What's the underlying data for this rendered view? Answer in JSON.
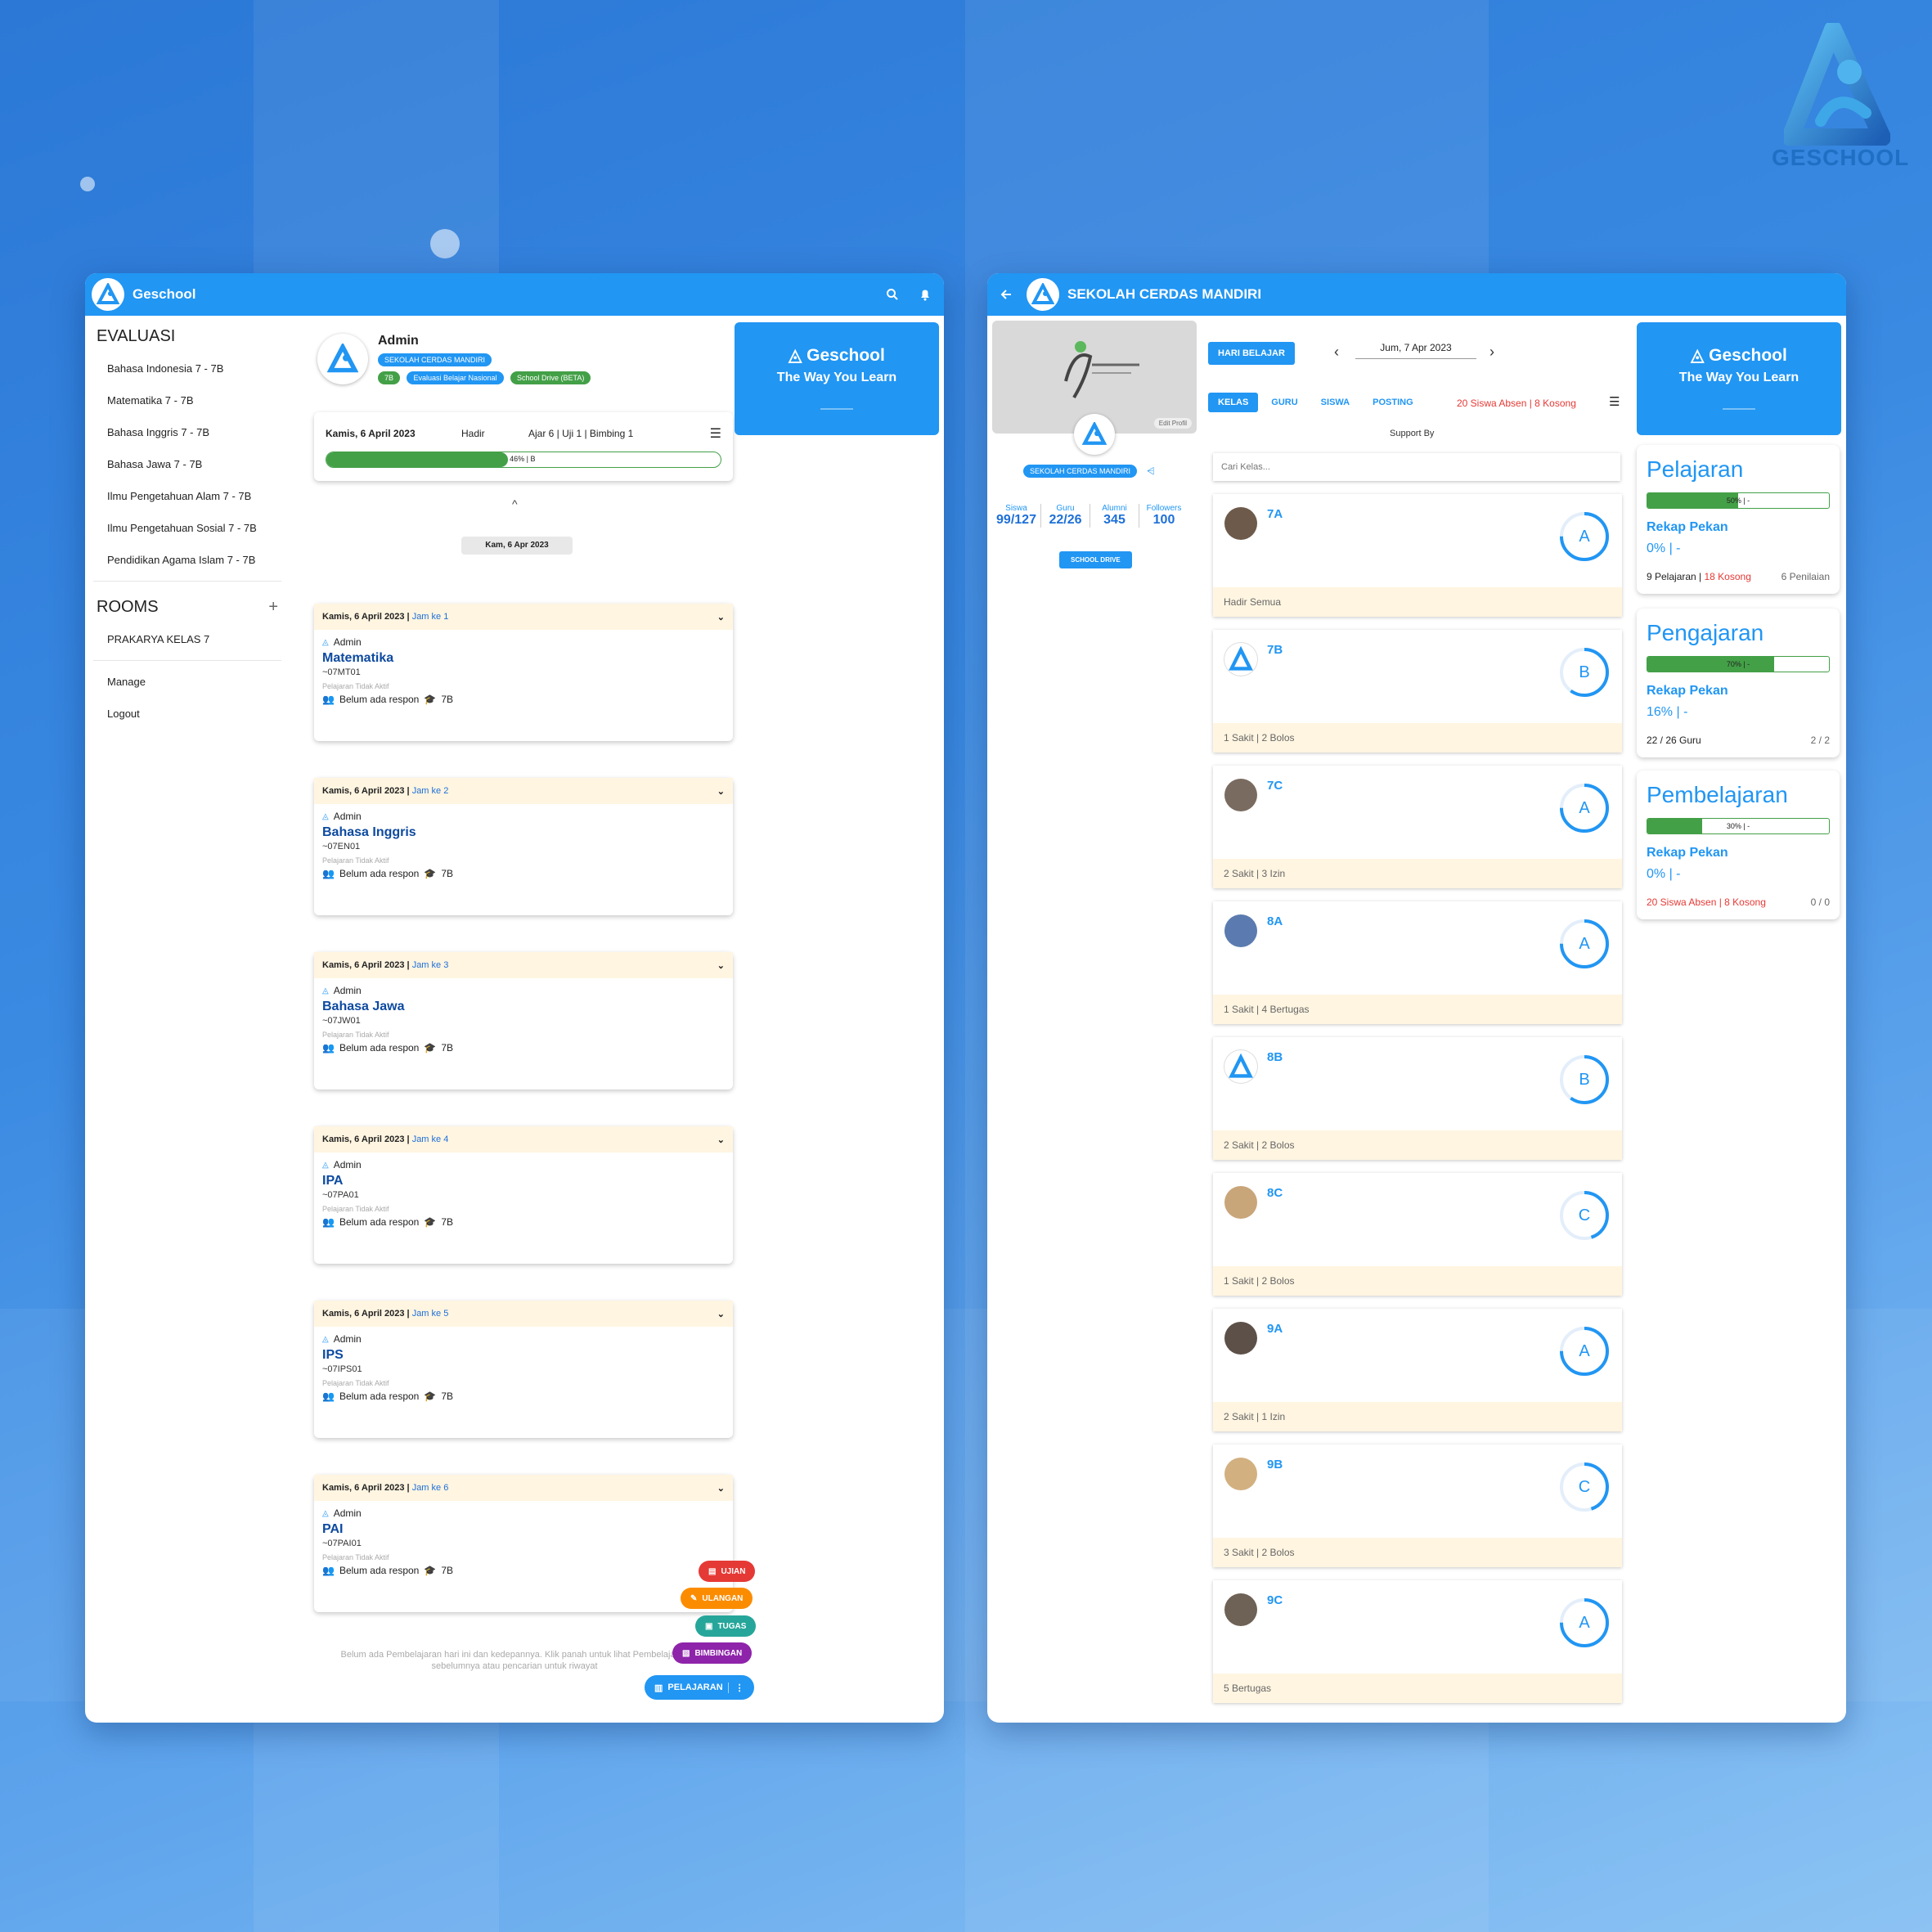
{
  "brand": {
    "name": "GESCHOOL"
  },
  "left": {
    "app_title": "Geschool",
    "evaluasi": {
      "title": "EVALUASI",
      "items": [
        "Bahasa Indonesia 7 - 7B",
        "Matematika 7 - 7B",
        "Bahasa Inggris 7 - 7B",
        "Bahasa Jawa 7 - 7B",
        "Ilmu Pengetahuan Alam 7 - 7B",
        "Ilmu Pengetahuan Sosial 7 - 7B",
        "Pendidikan Agama Islam 7 - 7B"
      ]
    },
    "rooms": {
      "title": "ROOMS",
      "items": [
        "PRAKARYA KELAS 7"
      ]
    },
    "manage": "Manage",
    "logout": "Logout",
    "profile": {
      "name": "Admin",
      "school_chip": "SEKOLAH CERDAS MANDIRI",
      "chips": [
        "7B",
        "Evaluasi Belajar Nasional",
        "School Drive (BETA)"
      ]
    },
    "summary": {
      "date": "Kamis, 6 April 2023",
      "hadir": "Hadir",
      "stats": "Ajar 6 | Uji 1 | Bimbing 1",
      "progress": 0.46,
      "progress_label": "46% | B"
    },
    "date_pill": "Kam, 6 Apr 2023",
    "schedule": [
      {
        "date": "Kamis, 6 April 2023",
        "jam": "Jam ke 1",
        "teacher": "Admin",
        "subject": "Matematika",
        "code": "~07MT01",
        "status": "Pelajaran Tidak Aktif",
        "respon": "Belum ada respon",
        "kelas": "7B"
      },
      {
        "date": "Kamis, 6 April 2023",
        "jam": "Jam ke 2",
        "teacher": "Admin",
        "subject": "Bahasa Inggris",
        "code": "~07EN01",
        "status": "Pelajaran Tidak Aktif",
        "respon": "Belum ada respon",
        "kelas": "7B"
      },
      {
        "date": "Kamis, 6 April 2023",
        "jam": "Jam ke 3",
        "teacher": "Admin",
        "subject": "Bahasa Jawa",
        "code": "~07JW01",
        "status": "Pelajaran Tidak Aktif",
        "respon": "Belum ada respon",
        "kelas": "7B"
      },
      {
        "date": "Kamis, 6 April 2023",
        "jam": "Jam ke 4",
        "teacher": "Admin",
        "subject": "IPA",
        "code": "~07PA01",
        "status": "Pelajaran Tidak Aktif",
        "respon": "Belum ada respon",
        "kelas": "7B"
      },
      {
        "date": "Kamis, 6 April 2023",
        "jam": "Jam ke 5",
        "teacher": "Admin",
        "subject": "IPS",
        "code": "~07IPS01",
        "status": "Pelajaran Tidak Aktif",
        "respon": "Belum ada respon",
        "kelas": "7B"
      },
      {
        "date": "Kamis, 6 April 2023",
        "jam": "Jam ke 6",
        "teacher": "Admin",
        "subject": "PAI",
        "code": "~07PAI01",
        "status": "Pelajaran Tidak Aktif",
        "respon": "Belum ada respon",
        "kelas": "7B"
      }
    ],
    "empty_note": "Belum ada Pembelajaran hari ini dan kedepannya. Klik panah untuk lihat Pembelajaran sebelumnya atau pencarian untuk riwayat",
    "fabs": [
      {
        "label": "UJIAN",
        "color": "#e53935"
      },
      {
        "label": "ULANGAN",
        "color": "#fb8c00"
      },
      {
        "label": "TUGAS",
        "color": "#26a69a"
      },
      {
        "label": "BIMBINGAN",
        "color": "#8e24aa"
      },
      {
        "label": "PELAJARAN",
        "color": "#2196f3"
      }
    ],
    "promo": {
      "title": "Geschool",
      "tagline": "The Way You Learn"
    }
  },
  "right": {
    "title": "SEKOLAH CERDAS MANDIRI",
    "edit_profile": "Edit Profil",
    "school_chip": "SEKOLAH CERDAS MANDIRI",
    "stats": [
      {
        "label": "Siswa",
        "value": "99/127"
      },
      {
        "label": "Guru",
        "value": "22/26"
      },
      {
        "label": "Alumni",
        "value": "345"
      },
      {
        "label": "Followers",
        "value": "100"
      }
    ],
    "school_drive": "SCHOOL DRIVE",
    "hari_belajar": "HARI BELAJAR",
    "date": "Jum, 7 Apr 2023",
    "tabs": [
      "KELAS",
      "GURU",
      "SISWA",
      "POSTING"
    ],
    "absen_note": "20 Siswa Absen | 8 Kosong",
    "support_by": "Support By",
    "search_placeholder": "Cari Kelas...",
    "classes": [
      {
        "name": "7A",
        "grade": "A",
        "note": "Hadir Semua"
      },
      {
        "name": "7B",
        "grade": "B",
        "note": "1 Sakit | 2 Bolos"
      },
      {
        "name": "7C",
        "grade": "A",
        "note": "2 Sakit | 3 Izin"
      },
      {
        "name": "8A",
        "grade": "A",
        "note": "1 Sakit | 4 Bertugas"
      },
      {
        "name": "8B",
        "grade": "B",
        "note": "2 Sakit | 2 Bolos"
      },
      {
        "name": "8C",
        "grade": "C",
        "note": "1 Sakit | 2 Bolos"
      },
      {
        "name": "9A",
        "grade": "A",
        "note": "2 Sakit | 1 Izin"
      },
      {
        "name": "9B",
        "grade": "C",
        "note": "3 Sakit | 2 Bolos"
      },
      {
        "name": "9C",
        "grade": "A",
        "note": "5 Bertugas"
      }
    ],
    "promo": {
      "title": "Geschool",
      "tagline": "The Way You Learn"
    },
    "cards": [
      {
        "title": "Pelajaran",
        "progress": 0.5,
        "bar_label": "50% | -",
        "rekap": "Rekap Pekan",
        "pct": "0% | -",
        "footer_left": "9 Pelajaran | ",
        "footer_red": "18 Kosong",
        "footer_right": "6 Penilaian"
      },
      {
        "title": "Pengajaran",
        "progress": 0.7,
        "bar_label": "70% | -",
        "rekap": "Rekap Pekan",
        "pct": "16% | -",
        "footer_left": "22 / 26 Guru",
        "footer_red": "",
        "footer_right": "2 / 2"
      },
      {
        "title": "Pembelajaran",
        "progress": 0.3,
        "bar_label": "30% | -",
        "rekap": "Rekap Pekan",
        "pct": "0% | -",
        "footer_left": "",
        "footer_red": "20 Siswa Absen | 8 Kosong",
        "footer_right": "0 / 0"
      }
    ]
  }
}
